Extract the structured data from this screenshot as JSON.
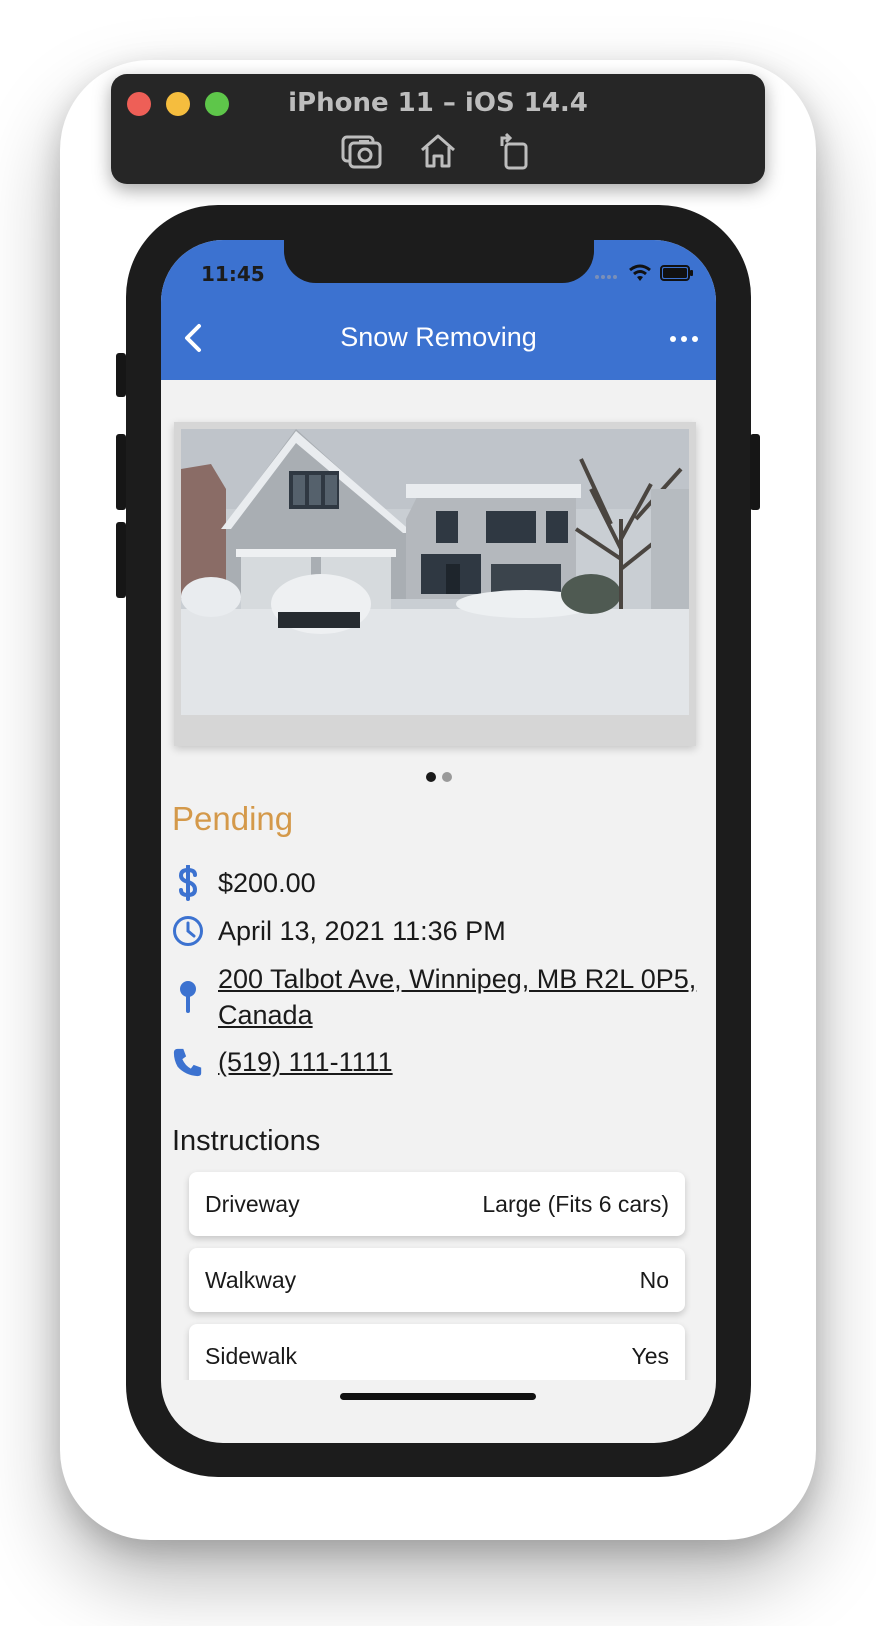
{
  "simulator": {
    "title": "iPhone 11 – iOS 14.4",
    "tools": [
      "screenshot-icon",
      "home-icon",
      "rotate-icon"
    ]
  },
  "status_bar": {
    "time": "11:45",
    "icons": [
      "signal-icon",
      "wifi-icon",
      "battery-icon"
    ]
  },
  "nav": {
    "title": "Snow Removing",
    "back_icon": "chevron-left-icon",
    "more_icon": "more-icon",
    "color": "#3c72d0"
  },
  "carousel": {
    "page_count": 2,
    "active_index": 0
  },
  "job": {
    "status": "Pending",
    "status_color": "#d4994a",
    "price": "$200.00",
    "datetime": "April 13, 2021 11:36 PM",
    "address_line1": "200 Talbot Ave, Winnipeg, MB R2L 0P5,",
    "address_line2": "Canada",
    "phone": "(519) 111-1111"
  },
  "instructions": {
    "title": "Instructions",
    "items": [
      {
        "label": "Driveway",
        "value": "Large (Fits 6 cars)"
      },
      {
        "label": "Walkway",
        "value": "No"
      },
      {
        "label": "Sidewalk",
        "value": "Yes"
      }
    ]
  }
}
